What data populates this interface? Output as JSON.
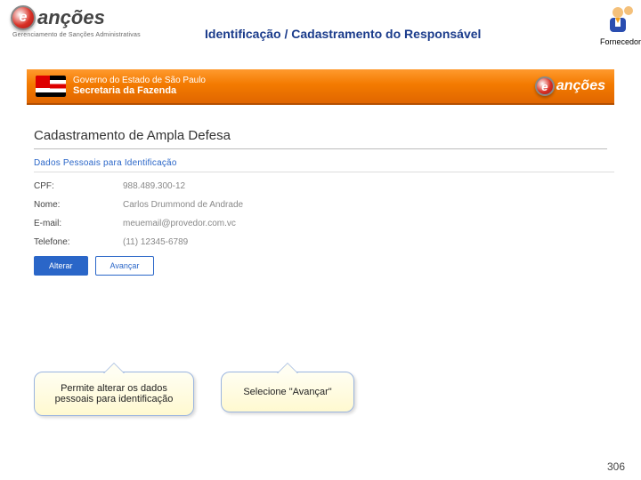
{
  "logo": {
    "letter": "e",
    "word": "anções",
    "sub": "Gerenciamento de Sanções Administrativas"
  },
  "title": "Identificação / Cadastramento do Responsável",
  "user_label": "Fornecedor",
  "app_header": {
    "line1": "Governo do Estado de São Paulo",
    "line2": "Secretaria da Fazenda"
  },
  "logo2": {
    "letter": "e",
    "word": "anções"
  },
  "section_title": "Cadastramento de Ampla Defesa",
  "subsection_title": "Dados Pessoais para Identificação",
  "form": {
    "cpf": {
      "label": "CPF:",
      "value": "988.489.300-12"
    },
    "nome": {
      "label": "Nome:",
      "value": "Carlos Drummond de Andrade"
    },
    "email": {
      "label": "E-mail:",
      "value": "meuemail@provedor.com.vc"
    },
    "telefone": {
      "label": "Telefone:",
      "value": "(11) 12345-6789"
    }
  },
  "buttons": {
    "alterar": "Alterar",
    "avancar": "Avançar"
  },
  "callouts": {
    "c1": "Permite alterar os dados pessoais para identificação",
    "c2": "Selecione \"Avançar\""
  },
  "page_number": "306"
}
